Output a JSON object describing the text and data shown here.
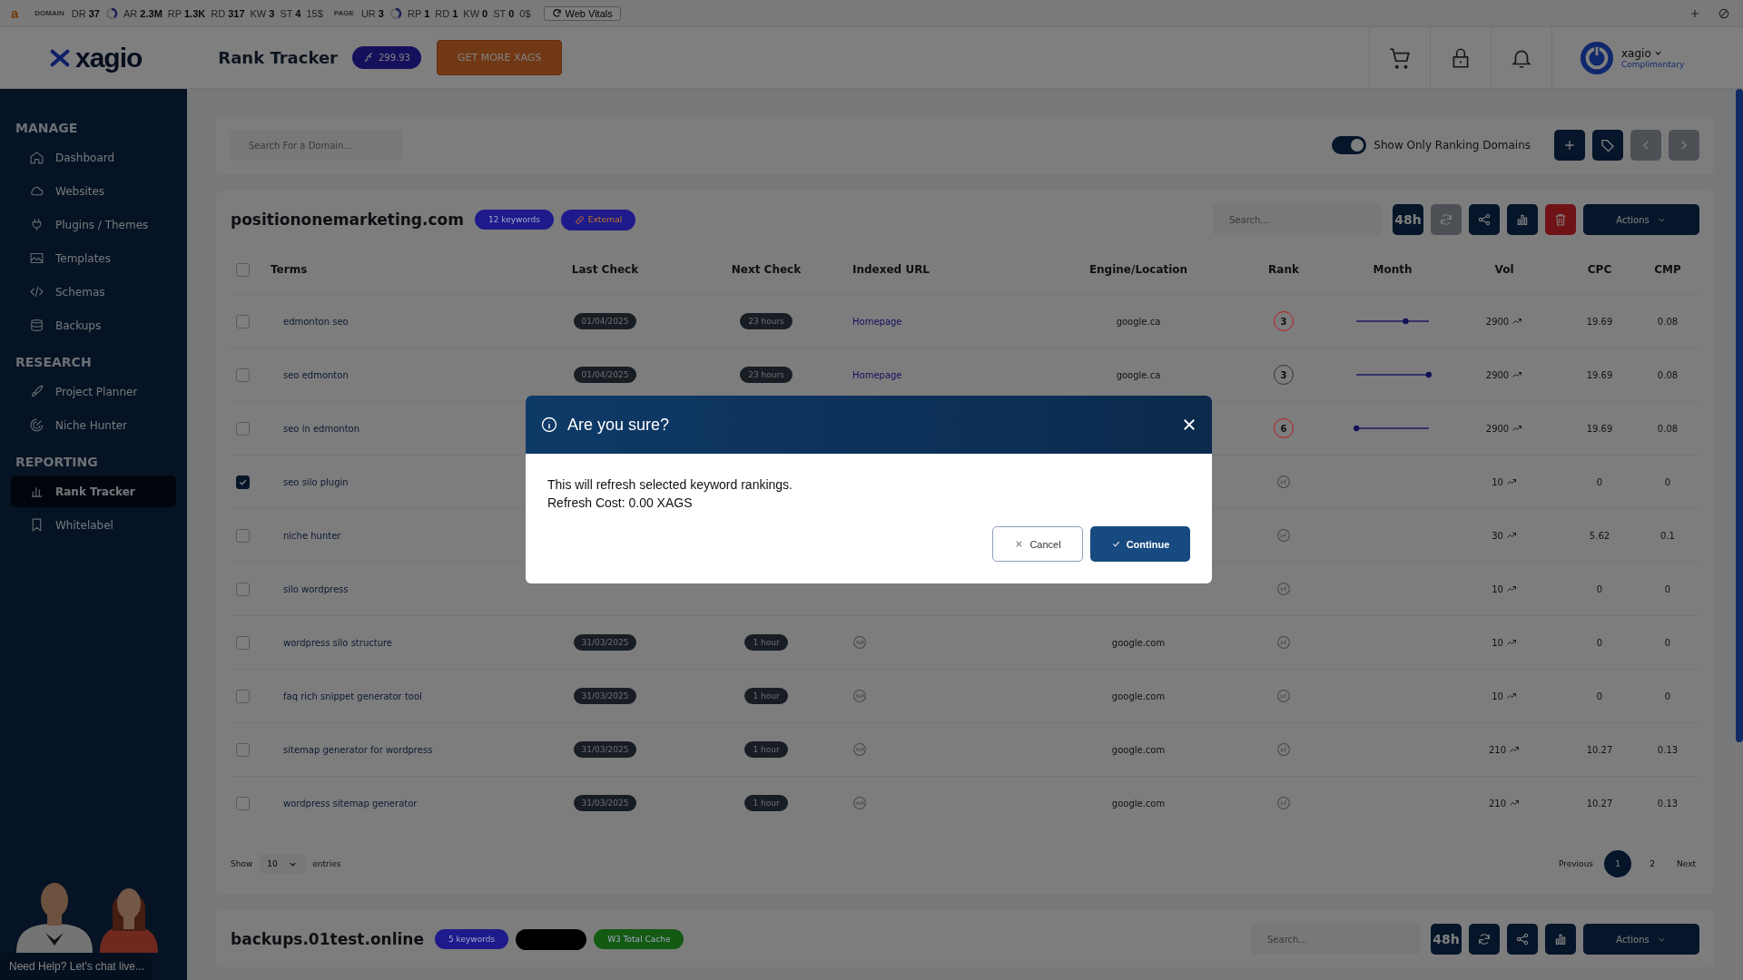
{
  "seo_toolbar": {
    "logo": "a",
    "groups": [
      {
        "label": "DOMAIN",
        "metrics": [
          {
            "name": "DR",
            "value": "37",
            "ring": true
          },
          {
            "name": "AR",
            "value": "2.3M",
            "ring": false
          },
          {
            "name": "RP",
            "value": "1.3K",
            "ring": false
          },
          {
            "name": "RD",
            "value": "317",
            "ring": false
          },
          {
            "name": "KW",
            "value": "3",
            "ring": false
          },
          {
            "name": "ST",
            "value": "4",
            "ring": false
          }
        ],
        "cost": "15$"
      },
      {
        "label": "PAGE",
        "metrics": [
          {
            "name": "UR",
            "value": "3",
            "ring": true
          },
          {
            "name": "RP",
            "value": "1",
            "ring": false
          },
          {
            "name": "RD",
            "value": "1",
            "ring": false
          },
          {
            "name": "KW",
            "value": "0",
            "ring": false
          },
          {
            "name": "ST",
            "value": "0",
            "ring": false
          }
        ],
        "cost": "0$"
      }
    ],
    "web_vitals": "Web Vitals"
  },
  "header": {
    "logo": "xagio",
    "title": "Rank Tracker",
    "balance": "299.93",
    "cta": "GET MORE XAGS",
    "user": {
      "name": "xagio",
      "plan": "Complimentary"
    }
  },
  "sidebar": {
    "sections": [
      {
        "title": "MANAGE",
        "items": [
          {
            "label": "Dashboard",
            "selected": false
          },
          {
            "label": "Websites",
            "selected": false
          },
          {
            "label": "Plugins / Themes",
            "selected": false
          },
          {
            "label": "Templates",
            "selected": false
          },
          {
            "label": "Schemas",
            "selected": false
          },
          {
            "label": "Backups",
            "selected": false
          }
        ]
      },
      {
        "title": "RESEARCH",
        "items": [
          {
            "label": "Project Planner",
            "selected": false
          },
          {
            "label": "Niche Hunter",
            "selected": false
          }
        ]
      },
      {
        "title": "REPORTING",
        "items": [
          {
            "label": "Rank Tracker",
            "selected": true
          },
          {
            "label": "Whitelabel",
            "selected": false
          }
        ]
      }
    ],
    "chat": {
      "label": "Need Help? Let's chat live..."
    }
  },
  "filters": {
    "search": {
      "placeholder": "Search For a Domain..."
    },
    "toggle": {
      "label": "Show Only Ranking Domains",
      "on": true
    },
    "buttons": [
      {
        "disabled": false
      },
      {
        "disabled": false
      },
      {
        "disabled": true
      },
      {
        "disabled": true
      }
    ]
  },
  "domains": [
    {
      "name": "positiononemarketing.com",
      "badges": [
        {
          "kind": "plain",
          "label": "12 keywords",
          "color": "#1e1a8c"
        },
        {
          "kind": "link",
          "label": "External",
          "color": "#1e1a8c"
        }
      ],
      "search": {
        "placeholder": "Search..."
      },
      "tools": [
        {
          "kind": "text",
          "label": "48h",
          "disabled": false
        },
        {
          "kind": "refresh",
          "disabled": true
        },
        {
          "kind": "share",
          "disabled": false
        },
        {
          "kind": "chart",
          "disabled": false
        },
        {
          "kind": "delete",
          "disabled": false
        }
      ],
      "actions": "Actions",
      "table": {
        "select_all": false,
        "columns": [
          "Terms",
          "Last Check",
          "Next Check",
          "Indexed URL",
          "Engine/Location",
          "Rank",
          "Month",
          "Vol",
          "CPC",
          "CMP"
        ],
        "rows": [
          {
            "checked": false,
            "term": "edmonton seo",
            "last_check": "01/04/2025",
            "next_check": "23 hours",
            "indexed_url": {
              "kind": "link",
              "text": "Homepage"
            },
            "engine": "google.ca",
            "rank": {
              "kind": "number",
              "value": "3",
              "color": "#b51d1d"
            },
            "month": {
              "level": 0.68
            },
            "vol": "2900",
            "cpc": "19.69",
            "cmp": "0.08"
          },
          {
            "checked": false,
            "term": "seo edmonton",
            "last_check": "01/04/2025",
            "next_check": "23 hours",
            "indexed_url": {
              "kind": "link",
              "text": "Homepage"
            },
            "engine": "google.ca",
            "rank": {
              "kind": "number",
              "value": "3",
              "color": "#333638"
            },
            "month": {
              "level": 1
            },
            "vol": "2900",
            "cpc": "19.69",
            "cmp": "0.08"
          },
          {
            "checked": false,
            "term": "seo in edmonton",
            "rank": {
              "kind": "number",
              "value": "6",
              "color": "#b51d1d"
            },
            "month": {
              "level": 0
            },
            "vol": "2900",
            "cpc": "19.69",
            "cmp": "0.08"
          },
          {
            "checked": true,
            "term": "seo silo plugin",
            "rank": {
              "kind": "none"
            },
            "vol": "10",
            "cpc": "0",
            "cmp": "0"
          },
          {
            "checked": false,
            "term": "niche hunter",
            "rank": {
              "kind": "none"
            },
            "vol": "30",
            "cpc": "5.62",
            "cmp": "0.1"
          },
          {
            "checked": false,
            "term": "silo wordpress",
            "rank": {
              "kind": "none"
            },
            "vol": "10",
            "cpc": "0",
            "cmp": "0"
          },
          {
            "checked": false,
            "term": "wordpress silo structure",
            "last_check": "31/03/2025",
            "next_check": "1 hour",
            "indexed_url": {
              "kind": "na"
            },
            "engine": "google.com",
            "rank": {
              "kind": "none"
            },
            "vol": "10",
            "cpc": "0",
            "cmp": "0"
          },
          {
            "checked": false,
            "term": "faq rich snippet generator tool",
            "last_check": "31/03/2025",
            "next_check": "1 hour",
            "indexed_url": {
              "kind": "na"
            },
            "engine": "google.com",
            "rank": {
              "kind": "none"
            },
            "vol": "10",
            "cpc": "0",
            "cmp": "0"
          },
          {
            "checked": false,
            "term": "sitemap generator for wordpress",
            "last_check": "31/03/2025",
            "next_check": "1 hour",
            "indexed_url": {
              "kind": "na"
            },
            "engine": "google.com",
            "rank": {
              "kind": "none"
            },
            "vol": "210",
            "cpc": "10.27",
            "cmp": "0.13"
          },
          {
            "checked": false,
            "term": "wordpress sitemap generator",
            "last_check": "31/03/2025",
            "next_check": "1 hour",
            "indexed_url": {
              "kind": "na"
            },
            "engine": "google.com",
            "rank": {
              "kind": "none"
            },
            "vol": "210",
            "cpc": "10.27",
            "cmp": "0.13"
          }
        ]
      },
      "footer": {
        "show": "Show",
        "page_size": "10",
        "entries": "entries",
        "previous": "Previous",
        "pages": [
          {
            "label": "1",
            "selected": true
          },
          {
            "label": "2",
            "selected": false
          }
        ],
        "next": "Next"
      }
    },
    {
      "name": "backups.01test.online",
      "badges": [
        {
          "kind": "plain",
          "label": "5 keywords",
          "color": "#1e1a8c"
        },
        {
          "kind": "redacted",
          "color": "#000000"
        },
        {
          "kind": "plain",
          "label": "W3 Total Cache",
          "color": "#135a13"
        }
      ],
      "search": {
        "placeholder": "Search..."
      },
      "tools": [
        {
          "kind": "text",
          "label": "48h",
          "disabled": false
        },
        {
          "kind": "refresh",
          "disabled": false
        },
        {
          "kind": "share",
          "disabled": false
        },
        {
          "kind": "chart",
          "disabled": false
        }
      ],
      "actions": "Actions"
    }
  ],
  "modal": {
    "title": "Are you sure?",
    "lines": [
      "This will refresh selected keyword rankings.",
      "Refresh Cost: 0.00 XAGS"
    ],
    "cancel": "Cancel",
    "confirm": "Continue"
  }
}
